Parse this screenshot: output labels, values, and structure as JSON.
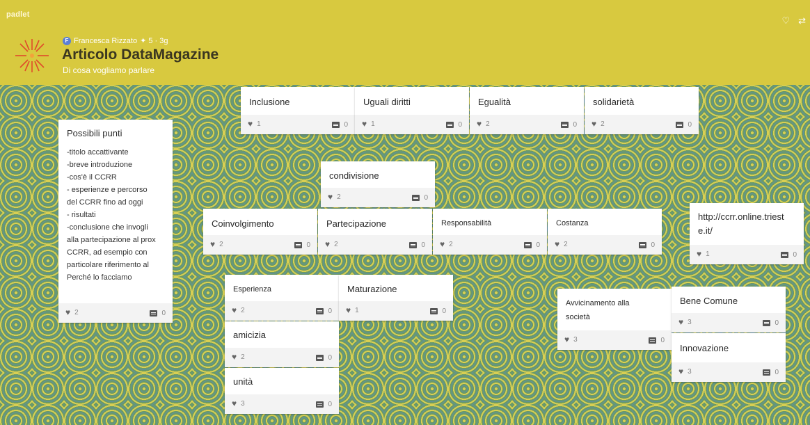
{
  "header": {
    "brand": "padlet",
    "author": "Francesca Rizzato",
    "avatar_initial": "F",
    "meta": "✦ 5 · 3g",
    "title": "Articolo DataMagazine",
    "subtitle": "Di cosa vogliamo parlare"
  },
  "cards": [
    {
      "title": "Inclusione",
      "likes": "1",
      "comments": "0"
    },
    {
      "title": "Uguali diritti",
      "likes": "1",
      "comments": "0"
    },
    {
      "title": "Egualità",
      "likes": "2",
      "comments": "0"
    },
    {
      "title": "solidarietà",
      "likes": "2",
      "comments": "0"
    },
    {
      "title": "Possibili punti",
      "likes": "2",
      "comments": "0",
      "lines": [
        "-titolo accattivante",
        "-breve introduzione",
        "-cos'è il CCRR",
        "-  esperienze e percorso",
        "del CCRR fino ad oggi",
        "- risultati",
        "-conclusione che invogli",
        "alla partecipazione al prox",
        "CCRR, ad esempio con",
        "particolare riferimento al",
        "Perché lo facciamo"
      ]
    },
    {
      "title": "condivisione",
      "likes": "2",
      "comments": "0"
    },
    {
      "title": "Coinvolgimento",
      "likes": "2",
      "comments": "0"
    },
    {
      "title": "Partecipazione",
      "likes": "2",
      "comments": "0"
    },
    {
      "title": "Responsabilità",
      "likes": "2",
      "comments": "0"
    },
    {
      "title": "Costanza",
      "likes": "2",
      "comments": "0"
    },
    {
      "title": "http://ccrr.online.triest",
      "title2": "e.it/",
      "likes": "1",
      "comments": "0"
    },
    {
      "title": "Esperienza",
      "likes": "2",
      "comments": "0"
    },
    {
      "title": "Maturazione",
      "likes": "1",
      "comments": "0"
    },
    {
      "title": "amicizia",
      "likes": "2",
      "comments": "0"
    },
    {
      "title": "unità",
      "likes": "3",
      "comments": "0"
    },
    {
      "title": "Avvicinamento alla",
      "title2": "società",
      "likes": "3",
      "comments": "0"
    },
    {
      "title": "Bene Comune",
      "likes": "3",
      "comments": "0"
    },
    {
      "title": "Innovazione",
      "likes": "3",
      "comments": "0"
    }
  ]
}
